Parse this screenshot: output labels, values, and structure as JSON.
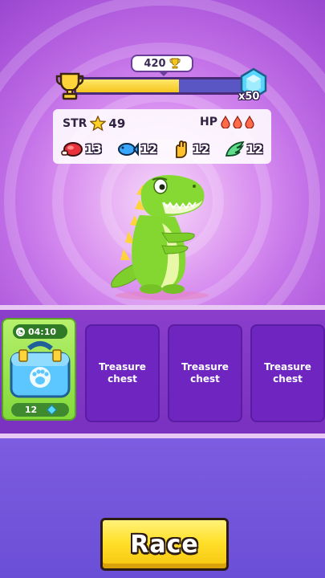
{
  "trophies": {
    "count": "420",
    "progress": 0.6
  },
  "gems": {
    "count": "x50"
  },
  "stats": {
    "str_label": "STR",
    "str_value": "49",
    "hp_label": "HP",
    "hp_drops": 3,
    "parts": [
      {
        "icon": "meat-icon",
        "value": "13"
      },
      {
        "icon": "fish-icon",
        "value": "12"
      },
      {
        "icon": "glove-icon",
        "value": "12"
      },
      {
        "icon": "wing-icon",
        "value": "12"
      }
    ]
  },
  "slots": {
    "active": {
      "timer": "04:10",
      "unlock_cost": "12"
    },
    "empty": [
      {
        "label": "Treasure chest"
      },
      {
        "label": "Treasure chest"
      },
      {
        "label": "Treasure chest"
      }
    ]
  },
  "race_button": {
    "label": "Race"
  },
  "colors": {
    "bar_fill": "#f5c51c",
    "bar_empty": "#5a56c4",
    "race_button": "#ffe02a",
    "slot_empty": "#6f25c0"
  }
}
